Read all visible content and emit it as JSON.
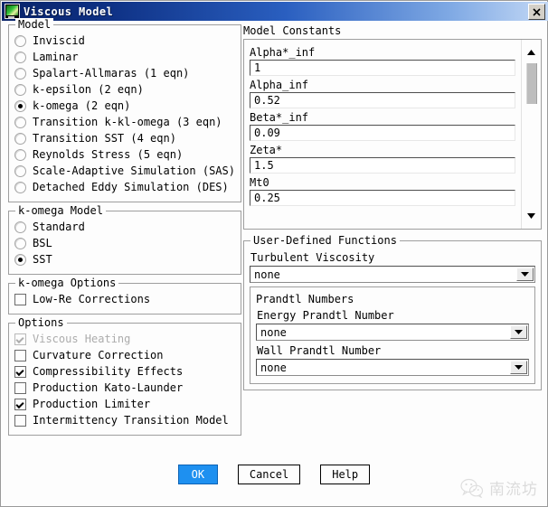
{
  "window": {
    "title": "Viscous Model",
    "icon": "fluent-app-icon",
    "close_label": "close-icon"
  },
  "model_group": {
    "legend": "Model",
    "items": [
      {
        "label": "Inviscid",
        "selected": false
      },
      {
        "label": "Laminar",
        "selected": false
      },
      {
        "label": "Spalart-Allmaras (1 eqn)",
        "selected": false
      },
      {
        "label": "k-epsilon (2 eqn)",
        "selected": false
      },
      {
        "label": "k-omega (2 eqn)",
        "selected": true
      },
      {
        "label": "Transition k-kl-omega (3 eqn)",
        "selected": false
      },
      {
        "label": "Transition SST (4 eqn)",
        "selected": false
      },
      {
        "label": "Reynolds Stress (5 eqn)",
        "selected": false
      },
      {
        "label": "Scale-Adaptive Simulation (SAS)",
        "selected": false
      },
      {
        "label": "Detached Eddy Simulation (DES)",
        "selected": false
      }
    ]
  },
  "komega_model_group": {
    "legend": "k-omega Model",
    "items": [
      {
        "label": "Standard",
        "selected": false
      },
      {
        "label": "BSL",
        "selected": false
      },
      {
        "label": "SST",
        "selected": true
      }
    ]
  },
  "komega_options_group": {
    "legend": "k-omega Options",
    "items": [
      {
        "label": "Low-Re Corrections",
        "checked": false,
        "disabled": false
      }
    ]
  },
  "options_group": {
    "legend": "Options",
    "items": [
      {
        "label": "Viscous Heating",
        "checked": true,
        "disabled": true
      },
      {
        "label": "Curvature Correction",
        "checked": false,
        "disabled": false
      },
      {
        "label": "Compressibility Effects",
        "checked": true,
        "disabled": false
      },
      {
        "label": "Production Kato-Launder",
        "checked": false,
        "disabled": false
      },
      {
        "label": "Production Limiter",
        "checked": true,
        "disabled": false
      },
      {
        "label": "Intermittency Transition Model",
        "checked": false,
        "disabled": false
      }
    ]
  },
  "model_constants": {
    "title": "Model Constants",
    "fields": [
      {
        "name": "Alpha*_inf",
        "value": "1"
      },
      {
        "name": "Alpha_inf",
        "value": "0.52"
      },
      {
        "name": "Beta*_inf",
        "value": "0.09"
      },
      {
        "name": "Zeta*",
        "value": "1.5"
      },
      {
        "name": "Mt0",
        "value": "0.25"
      }
    ],
    "scroll_up_icon": "scroll-up-arrow-icon",
    "scroll_down_icon": "scroll-down-arrow-icon"
  },
  "udf_group": {
    "legend": "User-Defined Functions",
    "turbulent_viscosity": {
      "label": "Turbulent Viscosity",
      "value": "none"
    },
    "prandtl": {
      "legend": "Prandtl Numbers",
      "energy": {
        "label": "Energy Prandtl Number",
        "value": "none"
      },
      "wall": {
        "label": "Wall Prandtl Number",
        "value": "none"
      }
    }
  },
  "buttons": {
    "ok": "OK",
    "cancel": "Cancel",
    "help": "Help"
  },
  "watermark": {
    "text": "南流坊",
    "icon": "wechat-logo-icon"
  },
  "colors": {
    "titlebar_start": "#0a246a",
    "titlebar_end": "#c3d8f5",
    "default_button": "#1e90f0",
    "dialog_bg": "#fdfdfd",
    "disabled_text": "#acacac"
  }
}
